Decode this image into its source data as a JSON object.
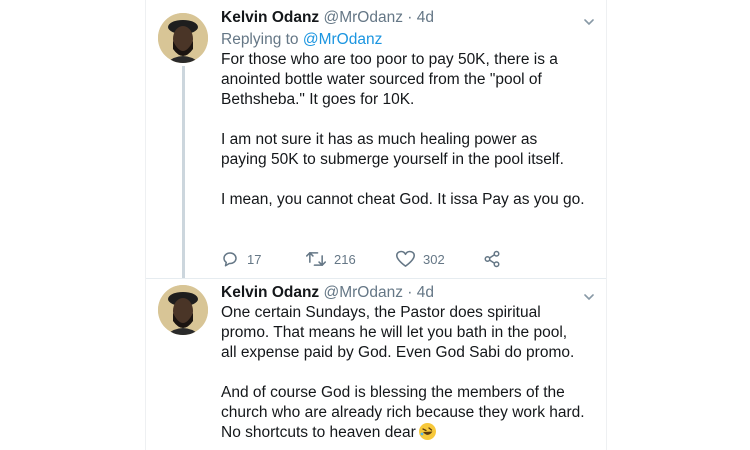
{
  "tweets": [
    {
      "author_name": "Kelvin Odanz",
      "handle": "@MrOdanz",
      "separator": "·",
      "time": "4d",
      "replying_prefix": "Replying to",
      "replying_to": "@MrOdanz",
      "paragraphs": [
        "For those who are too poor to pay 50K, there is a anointed bottle water sourced from the \"pool of Bethsheba.\" It goes for 10K.",
        "I am not sure it has as much healing power as paying 50K to submerge yourself in the pool itself.",
        "I mean, you cannot cheat God. It issa Pay as you go."
      ],
      "actions": {
        "replies": "17",
        "retweets": "216",
        "likes": "302"
      }
    },
    {
      "author_name": "Kelvin Odanz",
      "handle": "@MrOdanz",
      "separator": "·",
      "time": "4d",
      "paragraphs": [
        "One certain Sundays, the Pastor does spiritual promo. That means he will let you bath in the pool, all expense paid by God. Even God Sabi do promo.",
        "And of course God is blessing the members of the church who are already rich because they work hard. No shortcuts to heaven dear"
      ],
      "emoji": "rolling-on-floor-laughing-emoji"
    }
  ],
  "icons": {
    "reply": "reply-icon",
    "retweet": "retweet-icon",
    "like": "heart-icon",
    "share": "share-icon",
    "menu": "chevron-down-icon"
  },
  "colors": {
    "link": "#1b95e0",
    "muted": "#657786",
    "text": "#14171a",
    "thread_line": "#ccd6dd"
  }
}
